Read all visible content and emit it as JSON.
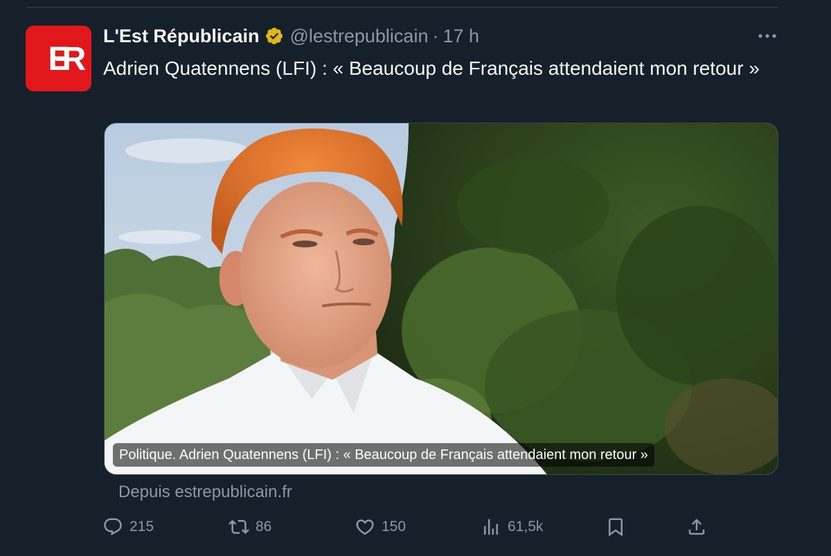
{
  "tweet": {
    "display_name": "L'Est Républicain",
    "handle": "@lestrepublicain",
    "separator": "·",
    "time": "17 h",
    "text": "Adrien Quatennens (LFI) : « Beaucoup de Français attendaient mon retour »",
    "avatar_logo_text": "ER"
  },
  "card": {
    "title": "Politique. Adrien Quatennens (LFI) : « Beaucoup de Français attendaient mon retour »",
    "source": "Depuis estrepublicain.fr"
  },
  "actions": {
    "replies": "215",
    "reposts": "86",
    "likes": "150",
    "views": "61,5k"
  },
  "colors": {
    "background": "#15202b",
    "avatar_red": "#e2171c",
    "verified_gold": "#e2b719",
    "muted_text": "#8b98a5"
  },
  "icons": [
    "more-icon",
    "verified-badge-icon",
    "reply-icon",
    "repost-icon",
    "like-icon",
    "views-icon",
    "bookmark-icon",
    "share-icon"
  ]
}
